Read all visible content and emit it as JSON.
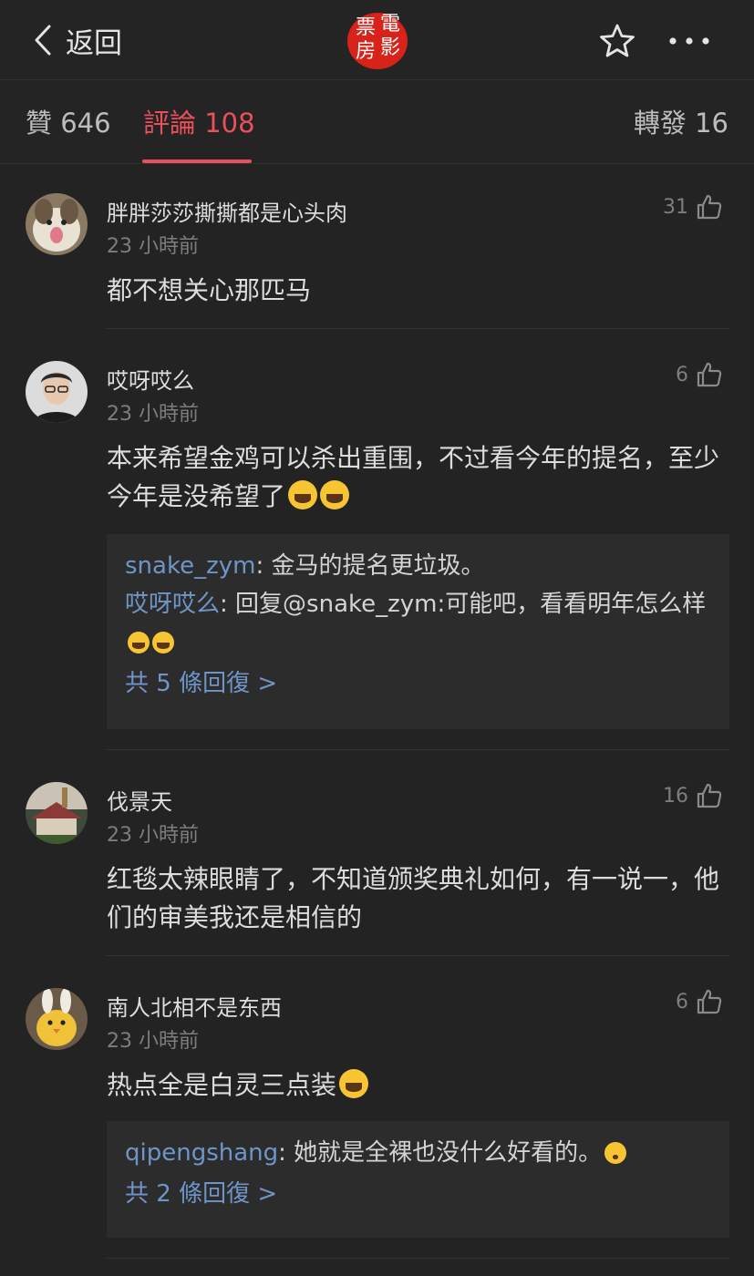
{
  "header": {
    "back_label": "返回",
    "logo_chars": [
      "票",
      "電",
      "房",
      "影"
    ],
    "logo_color": "#d8231b"
  },
  "tabs": {
    "likes": "贊 646",
    "comments": "評論 108",
    "reposts": "轉發 16",
    "active_color": "#e9505b"
  },
  "comments": [
    {
      "user": "胖胖莎莎撕撕都是心头肉",
      "time": "23 小時前",
      "likes": "31",
      "text": "都不想关心那匹马"
    },
    {
      "user": "哎呀哎么",
      "time": "23 小時前",
      "likes": "6",
      "text": "本来希望金鸡可以杀出重围，不过看今年的提名，至少今年是没希望了",
      "replies": [
        {
          "user": "snake_zym",
          "text": ": 金马的提名更垃圾。"
        },
        {
          "user": "哎呀哎么",
          "text": ": 回复@snake_zym:可能吧，看看明年怎么样"
        }
      ],
      "more_replies": "共 5 條回復 >"
    },
    {
      "user": "伐景天",
      "time": "23 小時前",
      "likes": "16",
      "text": "红毯太辣眼睛了，不知道颁奖典礼如何，有一说一，他们的审美我还是相信的"
    },
    {
      "user": "南人北相不是东西",
      "time": "23 小時前",
      "likes": "6",
      "text": "热点全是白灵三点装",
      "replies": [
        {
          "user": "qipengshang",
          "text": ": 她就是全裸也没什么好看的。"
        }
      ],
      "more_replies": "共 2 條回復 >"
    }
  ],
  "icons": {
    "back": "chevron-left-icon",
    "favorite": "star-icon",
    "more": "more-dots-icon",
    "like": "thumbs-up-icon",
    "laugh_emoji": "tears-of-joy-emoji-icon",
    "think_emoji": "thinking-emoji-icon"
  },
  "link_color": "#6f95c8"
}
